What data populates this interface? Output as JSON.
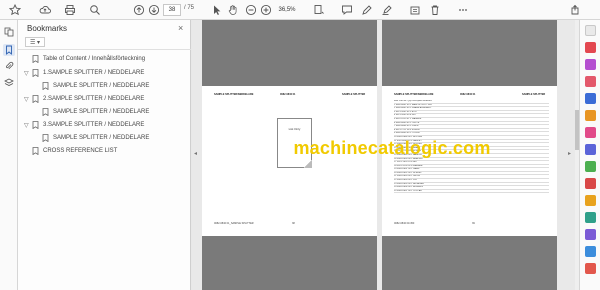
{
  "toolbar": {
    "page_current": "38",
    "page_separator": "/ 75",
    "zoom": "36,5%",
    "icons": [
      "star-icon",
      "cloud-upload-icon",
      "print-icon",
      "search-icon",
      "page-up-icon",
      "page-down-icon",
      "select-cursor-icon",
      "hand-icon",
      "zoom-out-icon",
      "zoom-in-icon",
      "page-fit-icon",
      "comment-icon",
      "pen-icon",
      "highlight-icon",
      "delete-icon",
      "share-icon"
    ]
  },
  "bookmarks": {
    "title": "Bookmarks",
    "close": "×",
    "menu_label": "☰ ▾",
    "items": [
      {
        "label": "Table of Content / Innehållsförteckning",
        "level": 0,
        "chevron": ""
      },
      {
        "label": "1.SAMPLE SPLITTER / NEDDELARE",
        "level": 0,
        "chevron": "▽"
      },
      {
        "label": "SAMPLE SPLITTER / NEDDELARE",
        "level": 1,
        "chevron": ""
      },
      {
        "label": "2.SAMPLE SPLITTER / NEDDELARE",
        "level": 0,
        "chevron": "▽"
      },
      {
        "label": "SAMPLE SPLITTER / NEDDELARE",
        "level": 1,
        "chevron": ""
      },
      {
        "label": "3.SAMPLE SPLITTER / NEDDELARE",
        "level": 0,
        "chevron": "▽"
      },
      {
        "label": "SAMPLE SPLITTER / NEDDELARE",
        "level": 1,
        "chevron": ""
      },
      {
        "label": "CROSS REFERENCE LIST",
        "level": 0,
        "chevron": ""
      }
    ]
  },
  "document": {
    "left_page": {
      "header_left": "SAMPLE SPLITTER/NEDDELARE",
      "header_mid": "0082-0840 01",
      "header_right": "SAMPLE SPLITTER",
      "list_only_label": "List Only",
      "footer_left": "0082-0840 01_SAMPLE SPLITTER",
      "footer_right": "38"
    },
    "right_page": {
      "header_left": "SAMPLE SPLITTER/NEDDELARE",
      "header_mid": "0082-0840 01",
      "header_right": "SAMPLE SPLITTER",
      "footer_left": "0082-0840 01/450",
      "footer_right": "39",
      "rows": [
        "Item   Part No.        Qty   Description                 Remarks",
        "1      0082-0841 00    1     SAMPLE SPLITTER             ",
        "2      0082-0842 00    1     FRAME ASSEMBLY              ",
        "3      0021-1602 45    2     BOLT                        ",
        "4      0021-1603 50    4     NUT                         ",
        "5      0022-5123 01    2     WASHER                      ",
        "6      0082-0843 00    1     CHUTE                       ",
        "7      0082-0844 00    1     PLATE                       ",
        "8      0021-1711 30    6     SCREW                       ",
        "9      0082-0845 00    1     COVER                       ",
        "10     0082-0846 00    1     HOPPER                      ",
        "11     0022-6000 10    2     GASKET                      ",
        "12     0082-0847 00    1     DIVIDER                     ",
        "13     0082-0848 00    1     SHAFT                       ",
        "14     0021-1715 20    4     SCREW                       ",
        "15     0082-0849 00    1     HANDLE                      ",
        "16     0082-0850 00    2     BRACKET                     ",
        "17     0021-1620 10    8     NUT                         ",
        "18     0022-5130 02    8     WASHER                      ",
        "19     0082-0851 00    1     LABEL                       ",
        "20     0082-0852 00    1     SPRING                      ",
        "21     0082-0853 00    1     LATCH                       ",
        "22     0082-0854 00    1     PIN                         ",
        "23     0082-0855 00    1     RETAINER                    ",
        "24     0082-0856 00    1     BUSHING                     ",
        "25     0082-0857 00    1     COLLAR                      "
      ]
    },
    "watermark": "machinecatalogic.com"
  },
  "colors": {
    "watermark": "#f1ca00",
    "page_background": "#7a7a7a",
    "viewer_background": "#e9e9e9"
  }
}
